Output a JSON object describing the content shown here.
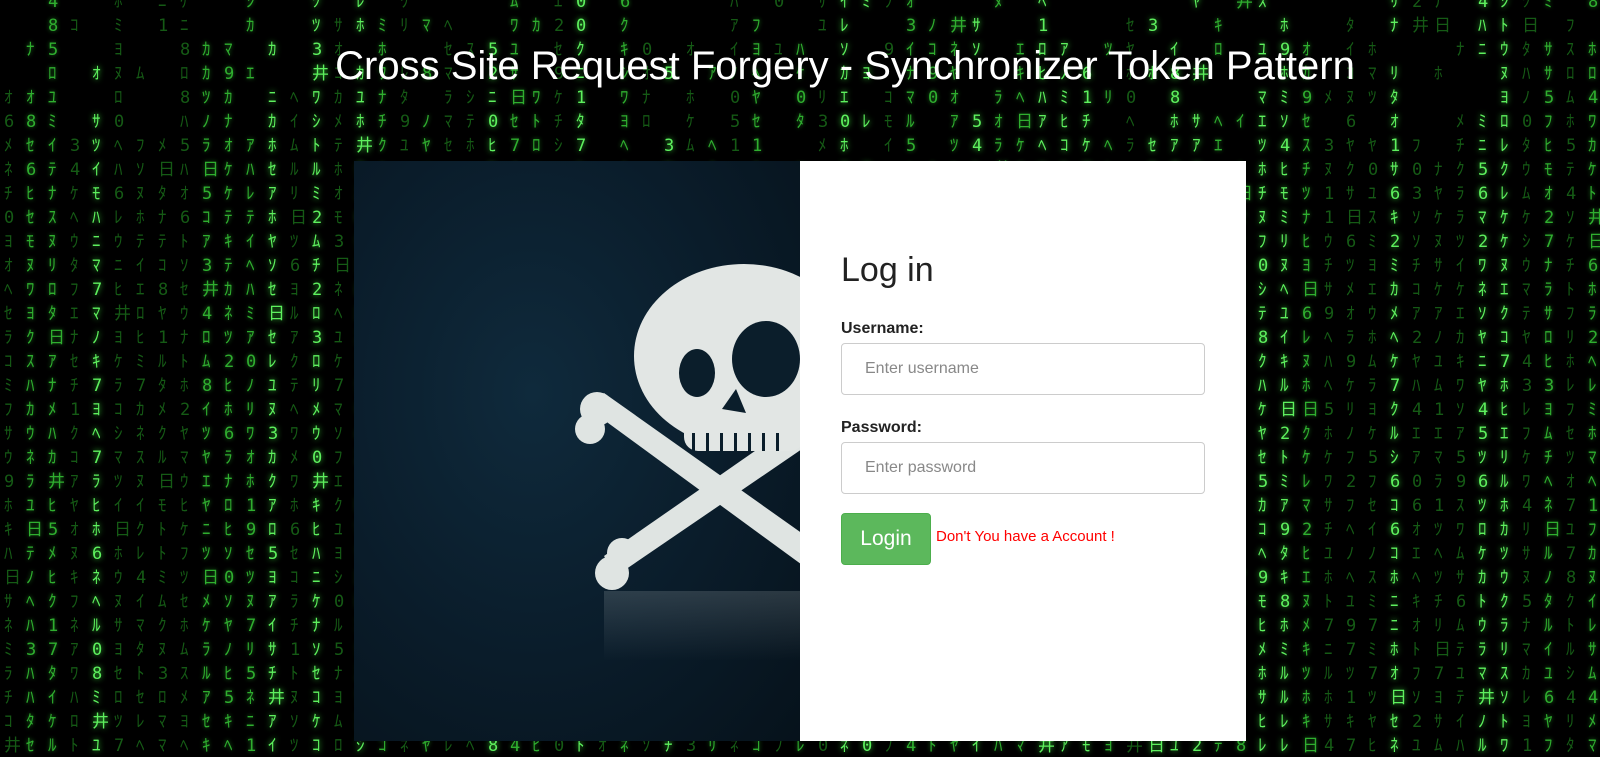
{
  "page": {
    "title": "Cross Site Request Forgery - Synchronizer Token Pattern"
  },
  "form": {
    "heading": "Log in",
    "username_label": "Username:",
    "username_placeholder": "Enter username",
    "password_label": "Password:",
    "password_placeholder": "Enter password",
    "login_label": "Login",
    "signup_link": "Don't You have a Account !"
  },
  "colors": {
    "login_button": "#5cb85c",
    "link": "#ff0000",
    "matrix_green": "#2fae2f"
  },
  "icons": {
    "hero_image": "skull-crossbones-icon"
  }
}
